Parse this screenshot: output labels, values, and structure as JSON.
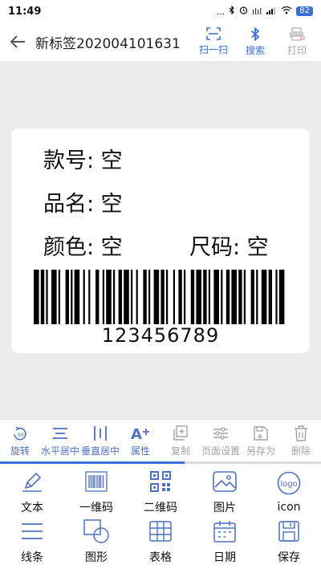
{
  "status": {
    "time": "11:49",
    "battery": "82",
    "dots": "...",
    "signal_text": "ılıl"
  },
  "header": {
    "title": "新标签202004101631",
    "actions": [
      {
        "label": "扫一扫",
        "icon": "scan-icon"
      },
      {
        "label": "搜索",
        "icon": "bluetooth-icon"
      },
      {
        "label": "打印",
        "icon": "printer-icon"
      }
    ]
  },
  "label": {
    "fields": [
      {
        "text": "款号:  空"
      },
      {
        "text": "品名:  空"
      },
      {
        "text": "颜色:  空"
      },
      {
        "text": "尺码:  空"
      }
    ],
    "barcode_value": "123456789"
  },
  "toolbar": [
    {
      "label": "旋转",
      "icon": "rotate-90-icon"
    },
    {
      "label": "水平居中",
      "icon": "horizontal-center-icon"
    },
    {
      "label": "垂直居中",
      "icon": "vertical-center-icon"
    },
    {
      "label": "属性",
      "icon": "text-properties-icon"
    },
    {
      "label": "复制",
      "icon": "copy-icon"
    },
    {
      "label": "页面设置",
      "icon": "page-settings-icon"
    },
    {
      "label": "另存为",
      "icon": "save-as-icon"
    },
    {
      "label": "删除",
      "icon": "delete-icon"
    }
  ],
  "palette": [
    {
      "label": "文本",
      "icon": "pen-icon"
    },
    {
      "label": "一维码",
      "icon": "barcode-icon"
    },
    {
      "label": "二维码",
      "icon": "qrcode-icon"
    },
    {
      "label": "图片",
      "icon": "image-icon"
    },
    {
      "label": "icon",
      "icon": "logo-icon",
      "logo_text": "logo"
    },
    {
      "label": "线条",
      "icon": "lines-icon"
    },
    {
      "label": "图形",
      "icon": "shapes-icon"
    },
    {
      "label": "表格",
      "icon": "table-icon"
    },
    {
      "label": "日期",
      "icon": "calendar-icon"
    },
    {
      "label": "保存",
      "icon": "save-icon"
    }
  ],
  "colors": {
    "accent": "#3d6fd8",
    "disabled": "#a4a4a4",
    "background": "#ebebeb"
  }
}
